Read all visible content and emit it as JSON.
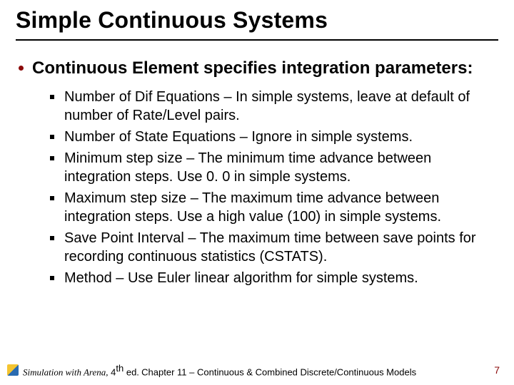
{
  "title": "Simple Continuous Systems",
  "main_point": "Continuous Element specifies integration parameters:",
  "items": [
    "Number of Dif Equations – In simple systems, leave at default of number of Rate/Level pairs.",
    "Number of State Equations – Ignore in simple systems.",
    "Minimum step size – The minimum time advance between integration steps. Use 0. 0 in simple systems.",
    "Maximum step size – The maximum time advance between integration steps. Use a high value (100) in simple systems.",
    "Save Point Interval – The maximum time between save points for recording continuous statistics (CSTATS).",
    "Method – Use Euler linear algorithm for simple systems."
  ],
  "footer": {
    "book": "Simulation with Arena,",
    "edition_pre": " 4",
    "edition_sup": "th",
    "edition_post": " ed.",
    "chapter": "Chapter 11 – Continuous & Combined Discrete/Continuous Models"
  },
  "page_number": "7"
}
